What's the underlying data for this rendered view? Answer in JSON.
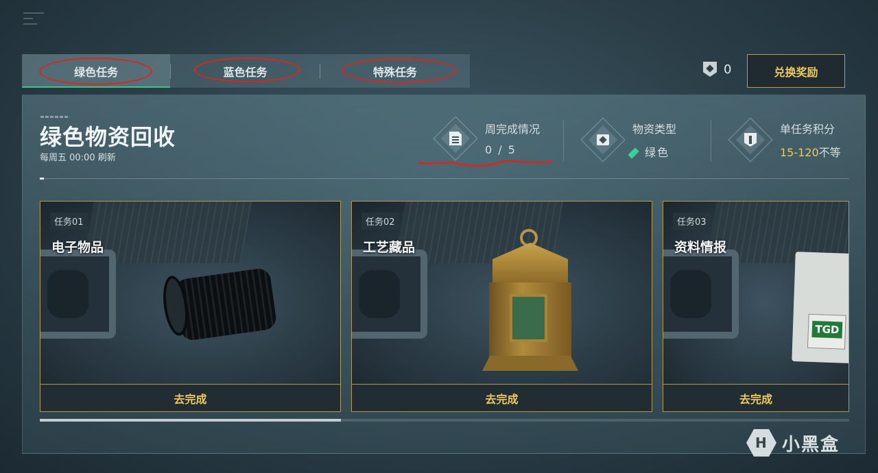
{
  "tabs": [
    {
      "label": "绿色任务",
      "active": true
    },
    {
      "label": "蓝色任务",
      "active": false
    },
    {
      "label": "特殊任务",
      "active": false
    }
  ],
  "header": {
    "points_value": "0",
    "redeem_label": "兑换奖励"
  },
  "panel": {
    "title": "绿色物资回收",
    "refresh_text": "每周五 00:00 刷新",
    "stats": {
      "weekly": {
        "label": "周完成情况",
        "value": "0 / 5",
        "icon": "document-icon"
      },
      "type": {
        "label": "物资类型",
        "value": "绿色",
        "icon": "supply-box-icon",
        "color": "#35d39a"
      },
      "score": {
        "label": "单任务积分",
        "value": "15-120",
        "suffix": "不等",
        "icon": "shield-icon",
        "color": "#f2c85a"
      }
    }
  },
  "cards": [
    {
      "tag": "任务01",
      "name": "电子物品",
      "button": "去完成"
    },
    {
      "tag": "任务02",
      "name": "工艺藏品",
      "button": "去完成"
    },
    {
      "tag": "任务03",
      "name": "资料情报",
      "button": "去完成"
    }
  ],
  "drive_label": "TGD",
  "watermark": {
    "text": "小黑盒"
  },
  "colors": {
    "accent_gold": "#f0c860",
    "accent_green": "#3fbf8a",
    "annotation_red": "#e0241a"
  }
}
